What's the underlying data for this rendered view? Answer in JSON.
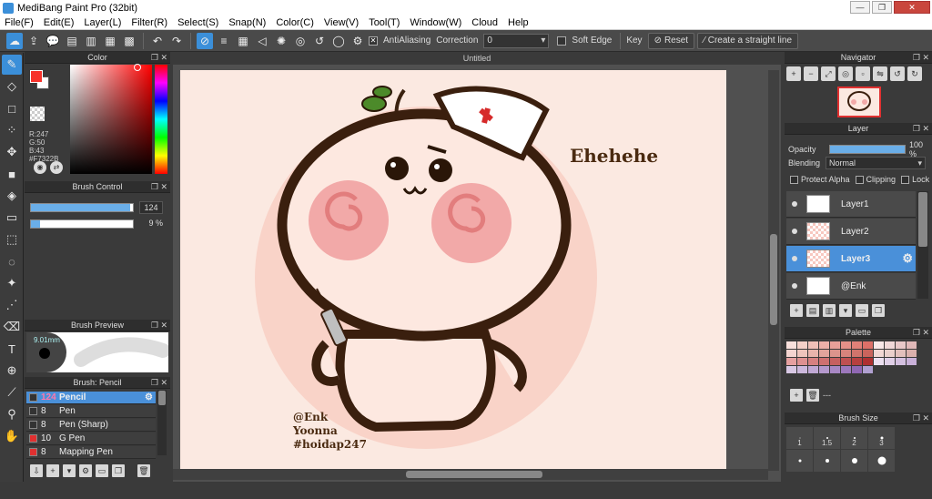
{
  "window": {
    "title": "MediBang Paint Pro (32bit)",
    "minimize": "—",
    "maximize": "❐",
    "close": "✕"
  },
  "menu": [
    "File(F)",
    "Edit(E)",
    "Layer(L)",
    "Filter(R)",
    "Select(S)",
    "Snap(N)",
    "Color(C)",
    "View(V)",
    "Tool(T)",
    "Window(W)",
    "Cloud",
    "Help"
  ],
  "toolbar": {
    "antialiasing_label": "AntiAliasing",
    "correction_label": "Correction",
    "correction_value": "0",
    "soft_edge_label": "Soft Edge",
    "key_label": "Key",
    "reset_label": "Reset",
    "straight_line_label": "Create a straight line"
  },
  "color_panel": {
    "title": "Color",
    "main_color": "#F7322B",
    "r": "R:247",
    "g": "G:50",
    "b": "B:43",
    "hex": "#F7322B"
  },
  "brush_control": {
    "title": "Brush Control",
    "size_value": "124",
    "size_fill": 0.97,
    "opacity_value": "9 %",
    "opacity_fill": 0.09
  },
  "brush_preview": {
    "title": "Brush Preview",
    "size_text": "9.01mm"
  },
  "brush_list": {
    "title": "Brush: Pencil",
    "items": [
      {
        "size": "124",
        "name": "Pencil",
        "color": "#333333",
        "active": true
      },
      {
        "size": "8",
        "name": "Pen",
        "color": "#333333",
        "active": false
      },
      {
        "size": "8",
        "name": "Pen (Sharp)",
        "color": "#333333",
        "active": false
      },
      {
        "size": "10",
        "name": "G Pen",
        "color": "#e03030",
        "active": false
      },
      {
        "size": "8",
        "name": "Mapping Pen",
        "color": "#e03030",
        "active": false
      }
    ]
  },
  "canvas": {
    "tab_title": "Untitled",
    "laugh_text": "Ehehehe",
    "sign_lines": [
      "@Enk",
      "Yoonna",
      "#hoidap247"
    ]
  },
  "navigator": {
    "title": "Navigator"
  },
  "layer_panel": {
    "title": "Layer",
    "opacity_label": "Opacity",
    "opacity_value": "100 %",
    "blending_label": "Blending",
    "blending_value": "Normal",
    "protect_alpha_label": "Protect Alpha",
    "clipping_label": "Clipping",
    "lock_label": "Lock",
    "layers": [
      {
        "name": "Layer1",
        "active": false
      },
      {
        "name": "Layer2",
        "active": false
      },
      {
        "name": "Layer3",
        "active": true
      },
      {
        "name": "@Enk",
        "active": false
      }
    ]
  },
  "palette": {
    "title": "Palette",
    "footer_text": "---",
    "colors": [
      "#f9e0dc",
      "#f5d0c8",
      "#f0c0b8",
      "#ecb0a8",
      "#e8a098",
      "#e49088",
      "#e08078",
      "#dc7068",
      "#f8e8e8",
      "#f0d8d8",
      "#e8c8c8",
      "#e0b8b8",
      "#f4d4d0",
      "#eec4bc",
      "#e8b4ac",
      "#e2a49c",
      "#dc948c",
      "#d6847c",
      "#d0746c",
      "#ca645c",
      "#f2d8d4",
      "#ead0cc",
      "#e2c0bc",
      "#dab0ac",
      "#e6a0a0",
      "#de9090",
      "#d68080",
      "#ce7070",
      "#c66060",
      "#be5050",
      "#b64040",
      "#ae3030",
      "#ece0f0",
      "#e0d0e8",
      "#d4c0e0",
      "#c8b0d8",
      "#d8c8e4",
      "#ccb8dc",
      "#c0a8d4",
      "#b498cc",
      "#a888c4",
      "#9c78bc",
      "#9068b4",
      "#b0a0d0"
    ]
  },
  "brush_size": {
    "title": "Brush Size",
    "labels": [
      "1",
      "1.5",
      "2",
      "3"
    ]
  }
}
